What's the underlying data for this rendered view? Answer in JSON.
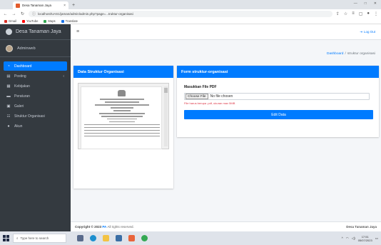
{
  "browser": {
    "tab_title": "Desa Tanaman Jaya",
    "tab_close": "×",
    "new_tab": "+",
    "url": "localhost/UAS1/jaman/admin/admin.php?page=...truktur-organisasi",
    "bookmarks": [
      {
        "label": "Gmail",
        "color": "#d93025"
      },
      {
        "label": "YouTube",
        "color": "#ff0000"
      },
      {
        "label": "Maps",
        "color": "#34a853"
      },
      {
        "label": "Translate",
        "color": "#1a73e8"
      }
    ]
  },
  "app": {
    "brand": "Desa Tanaman Jaya",
    "user": "Adminweb",
    "nav": [
      {
        "label": "Dashboard",
        "icon": "gauge-icon",
        "glyph": "◔",
        "active": true
      },
      {
        "label": "Posting",
        "icon": "file-icon",
        "glyph": "▤",
        "caret": "‹"
      },
      {
        "label": "Kebijakan",
        "icon": "book-icon",
        "glyph": "▦"
      },
      {
        "label": "Peraturan",
        "icon": "doc-icon",
        "glyph": "▬"
      },
      {
        "label": "Galeri",
        "icon": "image-icon",
        "glyph": "▣"
      },
      {
        "label": "Struktur Organisasi",
        "icon": "sitemap-icon",
        "glyph": "☷"
      },
      {
        "label": "Akun",
        "icon": "user-icon",
        "glyph": "●"
      }
    ],
    "logout": "Log Out",
    "breadcrumb": {
      "home": "Dashboard",
      "sep": "/",
      "current": "struktur organisasi"
    },
    "left_card_title": "Data Struktur Organisasi",
    "right_card_title": "Form struktur-organisasi",
    "form": {
      "label": "Masukkan File PDF",
      "file_button": "Choose File",
      "file_status": "No file chosen",
      "help": "File harus berupa .pdf, ukuran max 5MB",
      "submit": "Edit Data"
    },
    "footer": {
      "prefix": "Copyright © 2023",
      "link": "PA",
      "suffix": "All rights reserved.",
      "right": "Desa Tanaman Jaya"
    }
  },
  "taskbar": {
    "search_placeholder": "Type here to search",
    "time": "17:51",
    "date": "05/07/2023"
  }
}
